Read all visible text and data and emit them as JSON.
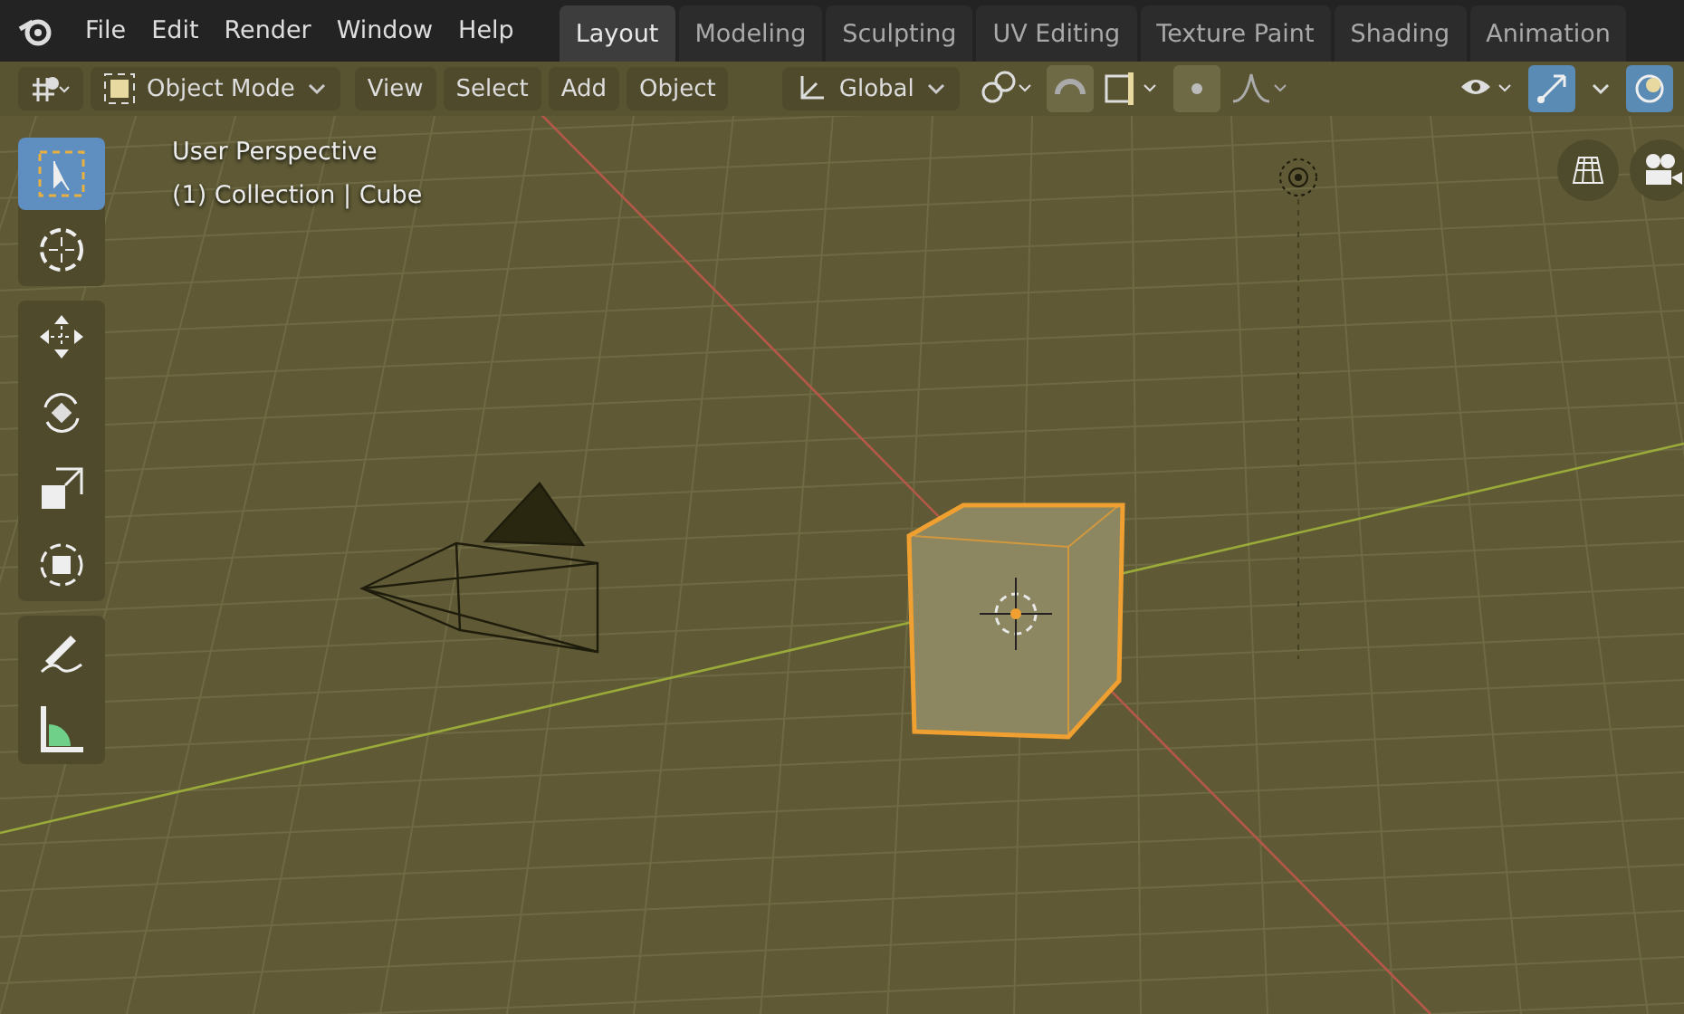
{
  "menu": [
    "File",
    "Edit",
    "Render",
    "Window",
    "Help"
  ],
  "workspaces": [
    {
      "label": "Layout",
      "selected": true
    },
    {
      "label": "Modeling",
      "selected": false
    },
    {
      "label": "Sculpting",
      "selected": false
    },
    {
      "label": "UV Editing",
      "selected": false
    },
    {
      "label": "Texture Paint",
      "selected": false
    },
    {
      "label": "Shading",
      "selected": false
    },
    {
      "label": "Animation",
      "selected": false
    }
  ],
  "header": {
    "mode": "Object Mode",
    "menus": [
      "View",
      "Select",
      "Add",
      "Object"
    ],
    "orientation": "Global"
  },
  "toolbar": [
    [
      {
        "kind": "select",
        "selected": true
      },
      {
        "kind": "cursor",
        "selected": false
      }
    ],
    [
      {
        "kind": "move",
        "selected": false
      },
      {
        "kind": "rotate",
        "selected": false
      },
      {
        "kind": "scale",
        "selected": false
      },
      {
        "kind": "transform",
        "selected": false
      }
    ],
    [
      {
        "kind": "annotate",
        "selected": false
      },
      {
        "kind": "measure",
        "selected": false
      }
    ]
  ],
  "viewport": {
    "view_name": "User Perspective",
    "context": "(1) Collection | Cube"
  }
}
